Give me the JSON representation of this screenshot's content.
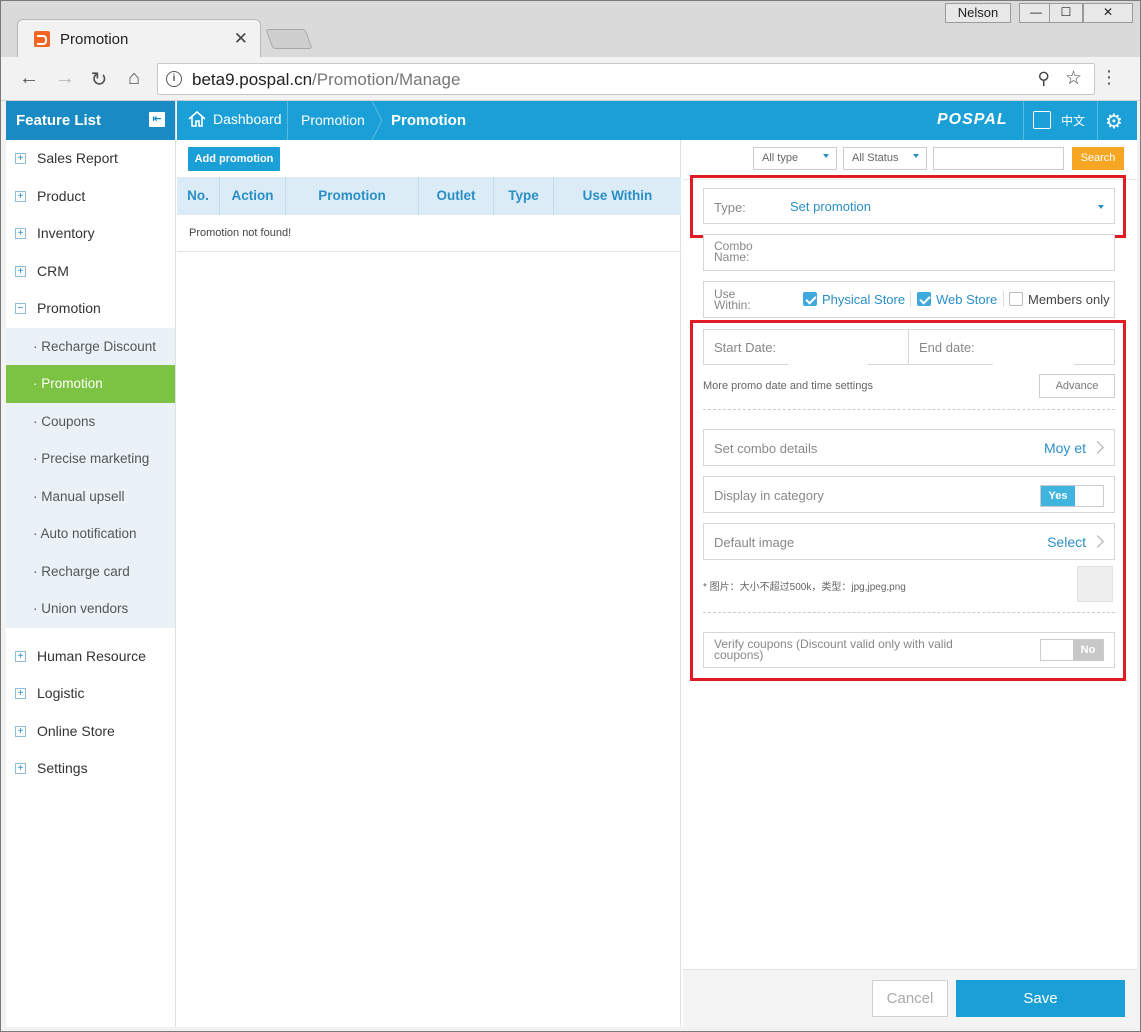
{
  "browser": {
    "tab_title": "Promotion",
    "tab_close": "✕",
    "user": "Nelson",
    "url_host": "beta9.pospal.cn",
    "url_path": "/Promotion/Manage"
  },
  "sidebar": {
    "title": "Feature List",
    "items": [
      {
        "label": "Sales Report"
      },
      {
        "label": "Product"
      },
      {
        "label": "Inventory"
      },
      {
        "label": "CRM"
      },
      {
        "label": "Promotion"
      }
    ],
    "subitems": [
      {
        "label": "· Recharge Discount"
      },
      {
        "label": "· Promotion"
      },
      {
        "label": "· Coupons"
      },
      {
        "label": "· Precise marketing"
      },
      {
        "label": "· Manual upsell"
      },
      {
        "label": "· Auto notification"
      },
      {
        "label": "· Recharge card"
      },
      {
        "label": "· Union vendors"
      }
    ],
    "items_after": [
      {
        "label": "Human Resource"
      },
      {
        "label": "Logistic"
      },
      {
        "label": "Online Store"
      },
      {
        "label": "Settings"
      }
    ]
  },
  "topbar": {
    "crumb_dashboard": "Dashboard",
    "crumb_promotion": "Promotion",
    "crumb_current": "Promotion",
    "logo": "POSPAL",
    "lang": "中文"
  },
  "list": {
    "add_button": "Add promotion",
    "columns": [
      "No.",
      "Action",
      "Promotion",
      "Outlet",
      "Type",
      "Use Within"
    ],
    "empty_text": "Promotion not found!"
  },
  "filters": {
    "type": "All type",
    "status": "All Status",
    "search_value": "",
    "search_button": "Search"
  },
  "form": {
    "type_label": "Type:",
    "type_value": "Set promotion",
    "combo_name_label_1": "Combo",
    "combo_name_label_2": "Name:",
    "use_within_label_1": "Use",
    "use_within_label_2": "Within:",
    "physical_store": "Physical Store",
    "web_store": "Web Store",
    "members_only": "Members only",
    "start_date_label": "Start Date:",
    "end_date_label": "End date:",
    "more_settings": "More promo date and time settings",
    "advance_button": "Advance",
    "combo_details_label": "Set combo details",
    "combo_details_value": "Moy et",
    "display_category_label": "Display in category",
    "display_category_toggle": "Yes",
    "default_image_label": "Default image",
    "default_image_value": "Select",
    "image_note": "* 图片：大小不超过500k，类型：jpg,jpeg,png",
    "verify_coupons_label_1": "Verify coupons (Discount valid only with valid",
    "verify_coupons_label_2": "coupons)",
    "verify_coupons_toggle": "No"
  },
  "footer": {
    "cancel": "Cancel",
    "save": "Save"
  },
  "colors": {
    "brand_blue": "#1a9fd7",
    "active_green": "#7cc243",
    "highlight_red": "#e01b24",
    "search_orange": "#f6a623"
  }
}
